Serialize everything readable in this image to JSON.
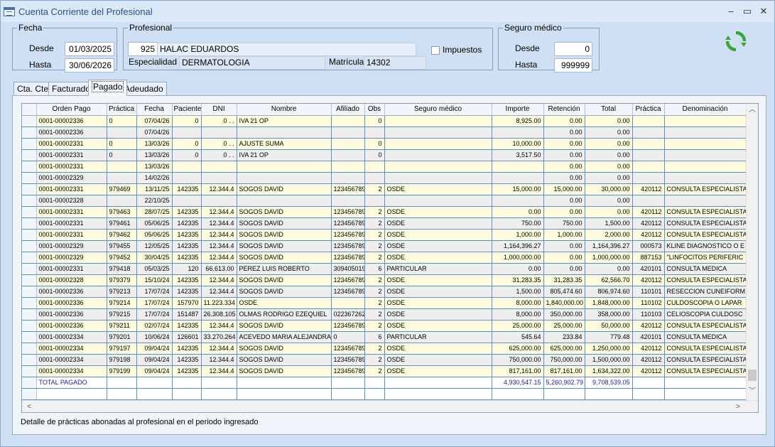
{
  "window": {
    "title": "Cuenta Corriente del Profesional",
    "buttons": {
      "minimize": "‒",
      "maximize": "▭",
      "close": "✕"
    }
  },
  "fecha": {
    "legend": "Fecha",
    "desde_label": "Desde",
    "desde_value": "01/03/2025",
    "hasta_label": "Hasta",
    "hasta_value": "30/06/2026"
  },
  "profesional": {
    "legend": "Profesional",
    "code": "925",
    "name": "HALAC EDUARDOS",
    "impuestos_label": "Impuestos",
    "especialidad_label": "Especialidad",
    "especialidad_value": "DERMATOLOGIA",
    "matricula_label": "Matrícula",
    "matricula_value": "14302"
  },
  "seguro": {
    "legend": "Seguro médico",
    "desde_label": "Desde",
    "desde_value": "0",
    "hasta_label": "Hasta",
    "hasta_value": "999999"
  },
  "tabs": [
    {
      "label": "Cta. Cte."
    },
    {
      "label": "Facturado"
    },
    {
      "label": "Pagado"
    },
    {
      "label": "Adeudado"
    }
  ],
  "grid": {
    "columns": [
      "Orden Pago",
      "Práctica",
      "Fecha",
      "Paciente",
      "DNI",
      "Nombre",
      "Afiliado",
      "Obs",
      "Seguro médico",
      "Importe",
      "Retención",
      "Total",
      "Práctica",
      "Denominación"
    ],
    "rows": [
      [
        "0001-00002336",
        "0",
        "07/04/26",
        "0",
        "0 . .",
        "IVA 21 OP",
        "",
        "0",
        "",
        "8,925.00",
        "0.00",
        "0.00",
        "",
        ""
      ],
      [
        "0001-00002336",
        "",
        "07/04/26",
        "",
        "",
        "",
        "",
        "",
        "",
        "",
        "0.00",
        "0.00",
        "",
        ""
      ],
      [
        "0001-00002331",
        "0",
        "13/03/26",
        "0",
        "0 . .",
        "AJUSTE SUMA",
        "",
        "0",
        "",
        "10,000.00",
        "0.00",
        "0.00",
        "",
        ""
      ],
      [
        "0001-00002331",
        "0",
        "13/03/26",
        "0",
        "0 . .",
        "IVA 21 OP",
        "",
        "0",
        "",
        "3,517.50",
        "0.00",
        "0.00",
        "",
        ""
      ],
      [
        "0001-00002331",
        "",
        "13/03/26",
        "",
        "",
        "",
        "",
        "",
        "",
        "",
        "0.00",
        "0.00",
        "",
        ""
      ],
      [
        "0001-00002329",
        "",
        "14/02/26",
        "",
        "",
        "",
        "",
        "",
        "",
        "",
        "0.00",
        "0.00",
        "",
        ""
      ],
      [
        "0001-00002331",
        "979469",
        "13/11/25",
        "142335",
        "12.344.4",
        "SOGOS DAVID",
        "123456789",
        "2",
        "OSDE",
        "15,000.00",
        "15,000.00",
        "30,000.00",
        "420112",
        "CONSULTA ESPECIALISTA"
      ],
      [
        "0001-00002328",
        "",
        "22/10/25",
        "",
        "",
        "",
        "",
        "",
        "",
        "",
        "0.00",
        "0.00",
        "",
        ""
      ],
      [
        "0001-00002331",
        "979463",
        "28/07/25",
        "142335",
        "12.344.4",
        "SOGOS DAVID",
        "123456789",
        "2",
        "OSDE",
        "0.00",
        "0.00",
        "0.00",
        "420112",
        "CONSULTA ESPECIALISTA"
      ],
      [
        "0001-00002331",
        "979461",
        "05/06/25",
        "142335",
        "12.344.4",
        "SOGOS DAVID",
        "123456789",
        "2",
        "OSDE",
        "750.00",
        "750.00",
        "1,500.00",
        "420112",
        "CONSULTA ESPECIALISTA"
      ],
      [
        "0001-00002331",
        "979462",
        "05/06/25",
        "142335",
        "12.344.4",
        "SOGOS DAVID",
        "123456789",
        "2",
        "OSDE",
        "1,000.00",
        "1,000.00",
        "2,000.00",
        "420112",
        "CONSULTA ESPECIALISTA"
      ],
      [
        "0001-00002329",
        "979455",
        "12/05/25",
        "142335",
        "12.344.4",
        "SOGOS DAVID",
        "123456789",
        "2",
        "OSDE",
        "1,164,396.27",
        "0.00",
        "1,164,396.27",
        "000573",
        "KLINE DIAGNOSTICO O E"
      ],
      [
        "0001-00002329",
        "979452",
        "30/04/25",
        "142335",
        "12.344.4",
        "SOGOS DAVID",
        "123456789",
        "2",
        "OSDE",
        "1,000,000.00",
        "0.00",
        "1,000,000.00",
        "887153",
        "\"LINFOCITOS PERIFERIC"
      ],
      [
        "0001-00002331",
        "979418",
        "05/03/25",
        "120",
        "66.613.00",
        "PEREZ LUIS ROBERTO",
        "309405019",
        "6",
        "PARTICULAR",
        "0.00",
        "0.00",
        "0.00",
        "420101",
        "CONSULTA MEDICA"
      ],
      [
        "0001-00002328",
        "979379",
        "15/10/24",
        "142335",
        "12.344.4",
        "SOGOS DAVID",
        "123456789",
        "2",
        "OSDE",
        "31,283.35",
        "31,283.35",
        "62,566.70",
        "420112",
        "CONSULTA ESPECIALISTA"
      ],
      [
        "0001-00002336",
        "979213",
        "17/07/24",
        "142335",
        "12.344.4",
        "SOGOS DAVID",
        "123456789",
        "2",
        "OSDE",
        "1,500.00",
        "805,474.60",
        "806,974.60",
        "110101",
        "RESECCION CUNEIFORM"
      ],
      [
        "0001-00002336",
        "979214",
        "17/07/24",
        "157970",
        "11.223.334",
        "OSDE",
        "",
        "2",
        "OSDE",
        "8,000.00",
        "1,840,000.00",
        "1,848,000.00",
        "110102",
        "CULDOSCOPIA O LAPAR"
      ],
      [
        "0001-00002336",
        "979215",
        "17/07/24",
        "151487",
        "26.308.105",
        "OLMAS RODRIGO EZEQUIEL",
        "022367262",
        "2",
        "OSDE",
        "8,000.00",
        "350,000.00",
        "358,000.00",
        "110103",
        "CELIOSCOPIA CULDOSC"
      ],
      [
        "0001-00002336",
        "979211",
        "02/07/24",
        "142335",
        "12.344.4",
        "SOGOS DAVID",
        "123456789",
        "2",
        "OSDE",
        "25,000.00",
        "25,000.00",
        "50,000.00",
        "420112",
        "CONSULTA ESPECIALISTA"
      ],
      [
        "0001-00002334",
        "979201",
        "10/06/24",
        "126601",
        "33.270.264",
        "ACEVEDO MARIA ALEJANDRA",
        "0",
        "6",
        "PARTICULAR",
        "545.64",
        "233.84",
        "779.48",
        "420101",
        "CONSULTA MEDICA"
      ],
      [
        "0001-00002334",
        "979197",
        "09/04/24",
        "142335",
        "12.344.4",
        "SOGOS DAVID",
        "123456789",
        "2",
        "OSDE",
        "625,000.00",
        "625,000.00",
        "1,250,000.00",
        "420112",
        "CONSULTA ESPECIALISTA"
      ],
      [
        "0001-00002334",
        "979198",
        "09/04/24",
        "142335",
        "12.344.4",
        "SOGOS DAVID",
        "123456789",
        "2",
        "OSDE",
        "750,000.00",
        "750,000.00",
        "1,500,000.00",
        "420112",
        "CONSULTA ESPECIALISTA"
      ],
      [
        "0001-00002334",
        "979199",
        "09/04/24",
        "142335",
        "12.344.4",
        "SOGOS DAVID",
        "123456789",
        "2",
        "OSDE",
        "817,161.00",
        "817,161.00",
        "1,634,322.00",
        "420112",
        "CONSULTA ESPECIALISTA"
      ]
    ],
    "total_row": {
      "label": "TOTAL PAGADO",
      "importe": "4,930,547.15",
      "retencion": "5,260,902.79",
      "total": "9,708,539.05"
    }
  },
  "status_text": "Detalle de prácticas abonadas al profesional en el periodo ingresado",
  "icons": {
    "refresh": "refresh-icon",
    "app": "window-app-icon"
  },
  "colors": {
    "row_odd": "#fdfbdc",
    "row_even": "#efeeee",
    "total_text": "#1a1a9c",
    "refresh": "#3aa63a"
  }
}
